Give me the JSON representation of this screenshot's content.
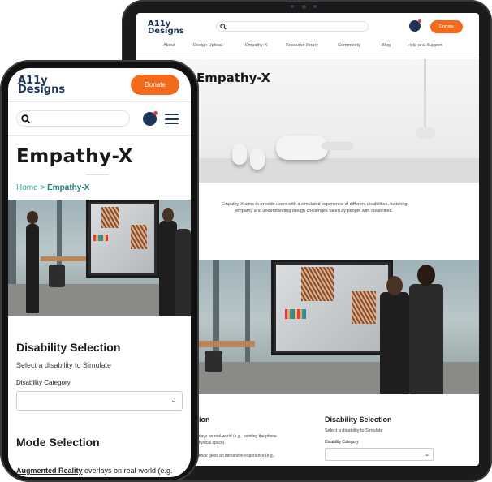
{
  "tablet": {
    "logo": {
      "line1": "A11y",
      "line2": "Designs"
    },
    "search_placeholder": "",
    "donate_label": "Donate",
    "nav": [
      "About",
      "Design Upload",
      "Empathy-X",
      "Resource library",
      "Community",
      "Blog",
      "Help and Support"
    ],
    "hero_title": "Empathy-X",
    "description": "Empathy-X aims to provide users with a simulated experience of different disabilities, fostering empathy and understanding design challenges faced by people with disabilities.",
    "mode_title_partial": "tion",
    "mode_text_1": "erlays on real-world (e.g., pointing the phone",
    "mode_text_2": "physical space).",
    "mode_text_3": "rience gives an immersive experience (e.g.,",
    "disability": {
      "title": "Disability Selection",
      "subtitle": "Select a disability to Simulate",
      "label": "Disability Category",
      "selected": ""
    }
  },
  "phone": {
    "logo": {
      "line1": "A11y",
      "line2": "Designs"
    },
    "donate_label": "Donate",
    "search_placeholder": "",
    "page_title": "Empathy-X",
    "breadcrumb": {
      "home": "Home",
      "separator": ">",
      "current": "Empathy-X"
    },
    "disability": {
      "title": "Disability Selection",
      "subtitle": "Select a disability to Simulate",
      "label": "Disability Category",
      "selected": ""
    },
    "mode": {
      "title": "Mode Selection",
      "ar_label": "Augmented Reality",
      "ar_text": " overlays on real-world (e.g."
    }
  },
  "colors": {
    "accent": "#f26b1d",
    "brand": "#1d3557",
    "breadcrumb": "#2a9d8f",
    "notification": "#e63946"
  },
  "icons": {
    "search": "search-icon",
    "user": "user-icon",
    "menu": "hamburger-menu-icon",
    "chevron": "chevron-down-icon"
  }
}
